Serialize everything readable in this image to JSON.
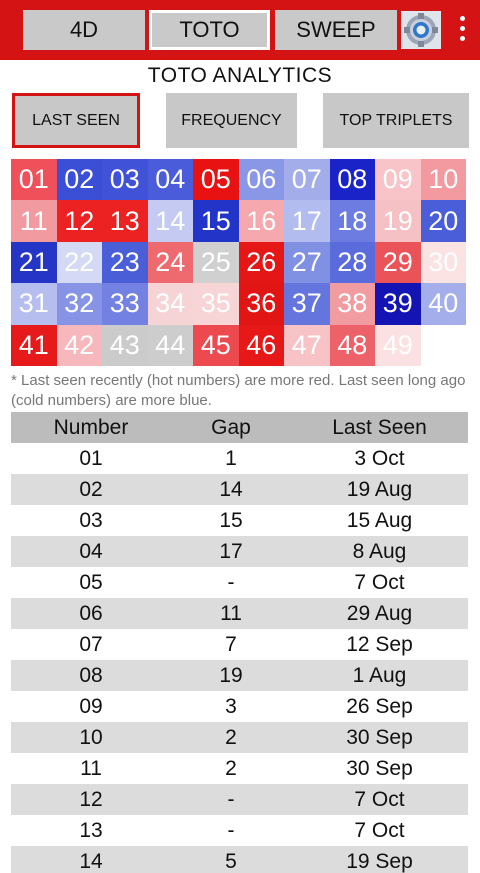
{
  "top_nav": {
    "tabs": [
      "4D",
      "TOTO",
      "SWEEP"
    ],
    "active_tab": "TOTO",
    "settings_icon": "settings-gear-icon",
    "menu_icon": "more-vert-icon",
    "colors": {
      "bar": "#d41414",
      "button": "#c9c9c9"
    }
  },
  "page_title": "TOTO ANALYTICS",
  "view_tabs": {
    "last_seen": "LAST SEEN",
    "frequency": "FREQUENCY",
    "top_triplets": "TOP TRIPLETS",
    "active": "LAST SEEN"
  },
  "heatmap": {
    "cells": [
      {
        "n": "01",
        "color": "#f0505a"
      },
      {
        "n": "02",
        "color": "#3a4ed6"
      },
      {
        "n": "03",
        "color": "#3f52d8"
      },
      {
        "n": "04",
        "color": "#4a5cd9"
      },
      {
        "n": "05",
        "color": "#e91212"
      },
      {
        "n": "06",
        "color": "#8a96e6"
      },
      {
        "n": "07",
        "color": "#a3adea"
      },
      {
        "n": "08",
        "color": "#1a23c8"
      },
      {
        "n": "09",
        "color": "#f8c4c8"
      },
      {
        "n": "10",
        "color": "#f29aa0"
      },
      {
        "n": "11",
        "color": "#f19aa0"
      },
      {
        "n": "12",
        "color": "#ec2121"
      },
      {
        "n": "13",
        "color": "#ec2121"
      },
      {
        "n": "14",
        "color": "#c4caf2"
      },
      {
        "n": "15",
        "color": "#2235c8"
      },
      {
        "n": "16",
        "color": "#f5a8ad"
      },
      {
        "n": "17",
        "color": "#b3bcee"
      },
      {
        "n": "18",
        "color": "#6c7ce0"
      },
      {
        "n": "19",
        "color": "#f6c1c4"
      },
      {
        "n": "20",
        "color": "#4a5ed9"
      },
      {
        "n": "21",
        "color": "#2535c6"
      },
      {
        "n": "22",
        "color": "#d4d9f6"
      },
      {
        "n": "23",
        "color": "#4a5ed8"
      },
      {
        "n": "24",
        "color": "#ee6a6e"
      },
      {
        "n": "25",
        "color": "#d0d0d0"
      },
      {
        "n": "26",
        "color": "#e41616"
      },
      {
        "n": "27",
        "color": "#8090e2"
      },
      {
        "n": "28",
        "color": "#5a6cdc"
      },
      {
        "n": "29",
        "color": "#ea5458"
      },
      {
        "n": "30",
        "color": "#fbe3e4"
      },
      {
        "n": "31",
        "color": "#b6bef0"
      },
      {
        "n": "32",
        "color": "#8794e6"
      },
      {
        "n": "33",
        "color": "#7281e2"
      },
      {
        "n": "34",
        "color": "#f6d4d6"
      },
      {
        "n": "35",
        "color": "#f7d4d6"
      },
      {
        "n": "36",
        "color": "#e21515"
      },
      {
        "n": "37",
        "color": "#6575de"
      },
      {
        "n": "38",
        "color": "#f19ca0"
      },
      {
        "n": "39",
        "color": "#1414b4"
      },
      {
        "n": "40",
        "color": "#a4aeea"
      },
      {
        "n": "41",
        "color": "#e61a1a"
      },
      {
        "n": "42",
        "color": "#f6b8bc"
      },
      {
        "n": "43",
        "color": "#cbcbcb"
      },
      {
        "n": "44",
        "color": "#cdcdcd"
      },
      {
        "n": "45",
        "color": "#ec4a4f"
      },
      {
        "n": "46",
        "color": "#e61818"
      },
      {
        "n": "47",
        "color": "#f7c3c6"
      },
      {
        "n": "48",
        "color": "#ec6268"
      },
      {
        "n": "49",
        "color": "#fbe1e2"
      }
    ]
  },
  "note": "* Last seen recently (hot numbers) are more red. Last seen long ago (cold numbers) are more blue.",
  "table": {
    "headers": [
      "Number",
      "Gap",
      "Last Seen"
    ],
    "rows": [
      [
        "01",
        "1",
        "3 Oct"
      ],
      [
        "02",
        "14",
        "19 Aug"
      ],
      [
        "03",
        "15",
        "15 Aug"
      ],
      [
        "04",
        "17",
        "8 Aug"
      ],
      [
        "05",
        "-",
        "7 Oct"
      ],
      [
        "06",
        "11",
        "29 Aug"
      ],
      [
        "07",
        "7",
        "12 Sep"
      ],
      [
        "08",
        "19",
        "1 Aug"
      ],
      [
        "09",
        "3",
        "26 Sep"
      ],
      [
        "10",
        "2",
        "30 Sep"
      ],
      [
        "11",
        "2",
        "30 Sep"
      ],
      [
        "12",
        "-",
        "7 Oct"
      ],
      [
        "13",
        "-",
        "7 Oct"
      ],
      [
        "14",
        "5",
        "19 Sep"
      ]
    ]
  }
}
